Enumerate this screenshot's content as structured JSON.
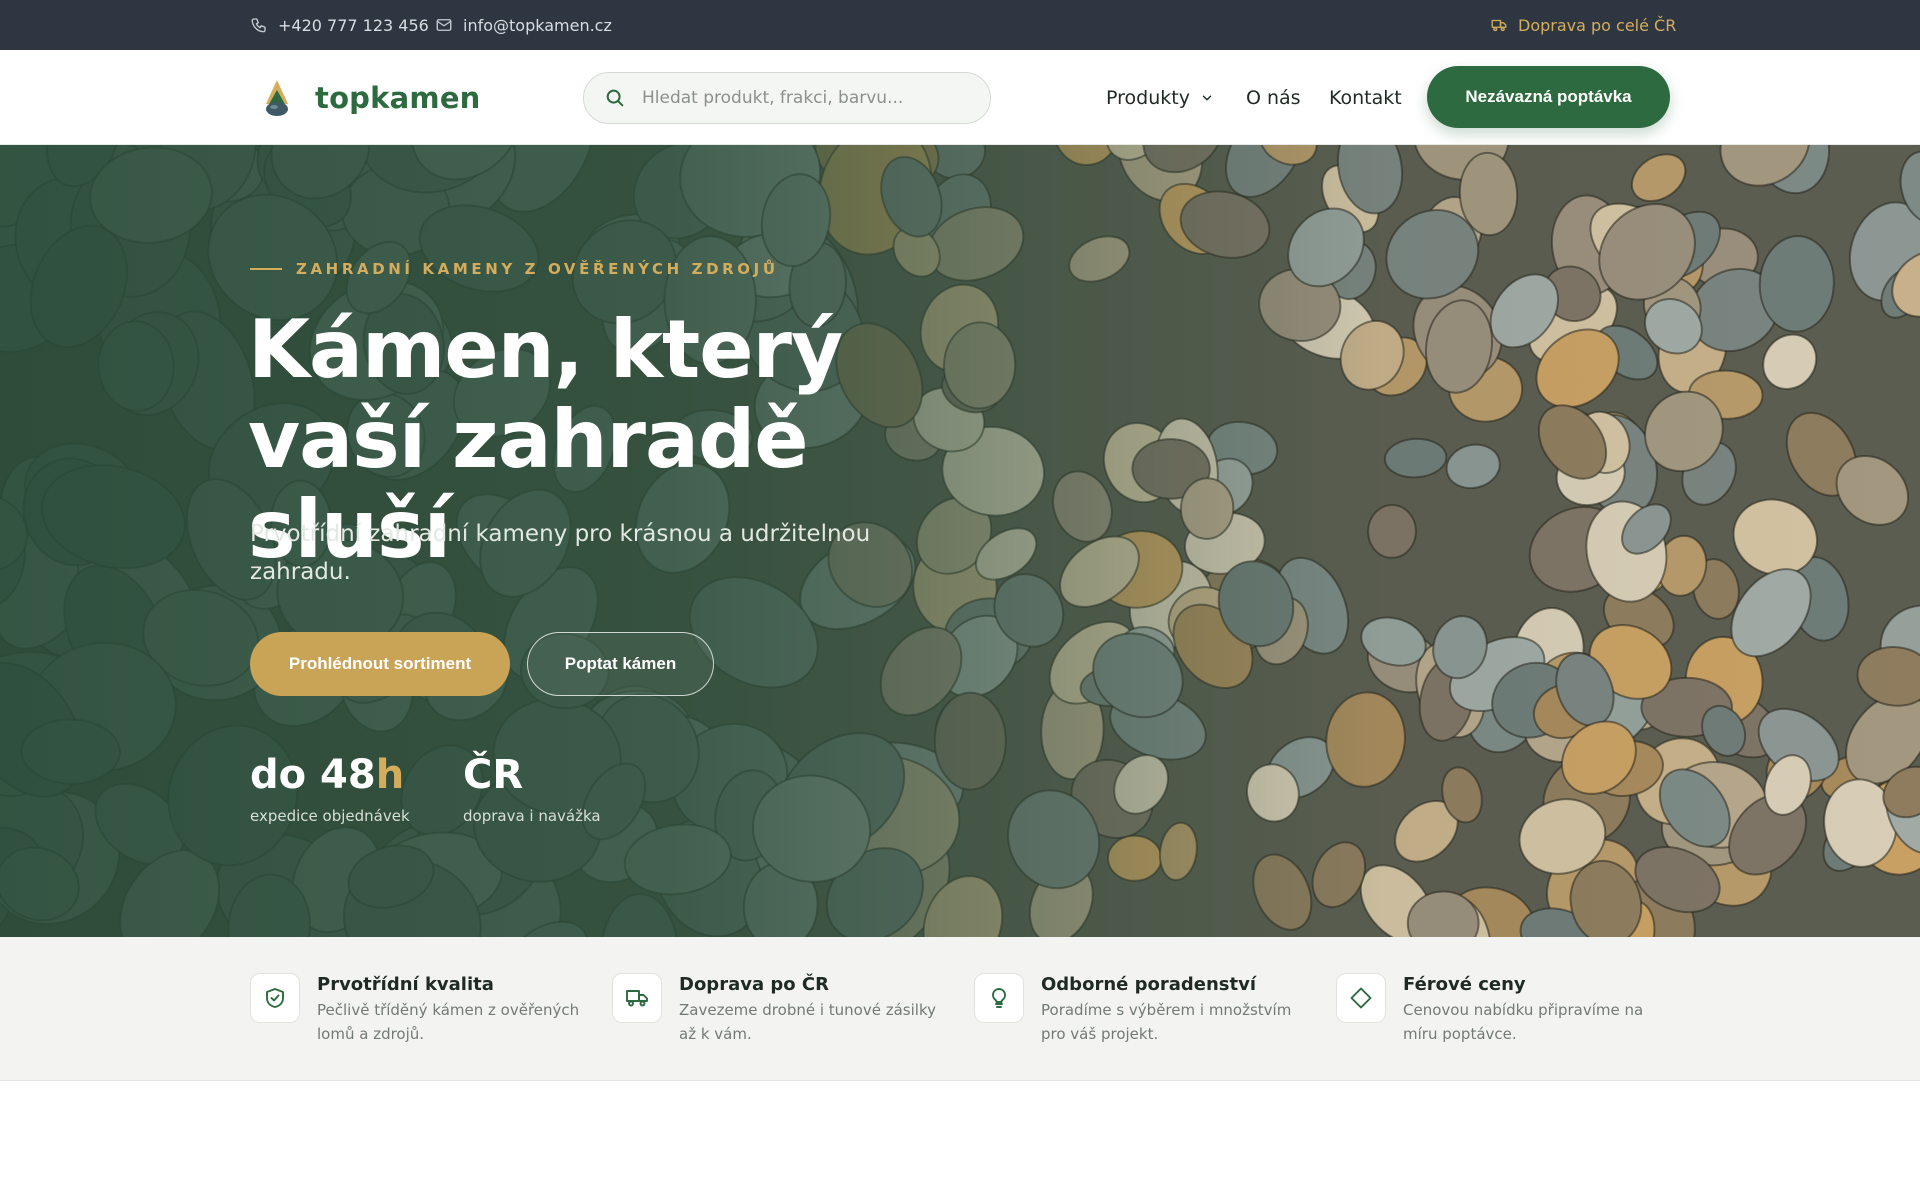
{
  "topbar": {
    "phone": "+420 777 123 456",
    "email": "info@topkamen.cz",
    "delivery": "Doprava po celé ČR"
  },
  "header": {
    "brand": "topkamen",
    "search_placeholder": "Hledat produkt, frakci, barvu...",
    "nav": {
      "products": "Produkty",
      "about": "O nás",
      "contact": "Kontakt"
    },
    "cta": "Nezávazná poptávka"
  },
  "hero": {
    "eyebrow": "ZAHRADNÍ KAMENY Z OVĚŘENÝCH ZDROJŮ",
    "title": "Kámen, který vaší zahradě sluší",
    "lead": "Prvotřídní zahradní kameny pro krásnou a udržitelnou zahradu.",
    "primary_button": "Prohlédnout sortiment",
    "secondary_button": "Poptat kámen",
    "stats": [
      {
        "value": "do 48",
        "value_accent": "h",
        "label": "expedice objednávek"
      },
      {
        "value": "ČR",
        "value_accent": "",
        "label": "doprava i navážka"
      }
    ]
  },
  "features": [
    {
      "icon": "shield-check-icon",
      "title": "Prvotřídní kvalita",
      "desc": "Pečlivě tříděný kámen z ověřených lomů a zdrojů."
    },
    {
      "icon": "truck-icon",
      "title": "Doprava po ČR",
      "desc": "Zavezeme drobné i tunové zásilky až k vám."
    },
    {
      "icon": "lightbulb-icon",
      "title": "Odborné poradenství",
      "desc": "Poradíme s výběrem i množstvím pro váš projekt."
    },
    {
      "icon": "diamond-icon",
      "title": "Férové ceny",
      "desc": "Cenovou nabídku připravíme na míru poptávce."
    }
  ],
  "colors": {
    "brand_green": "#2d6a3f",
    "accent_gold": "#c9a356",
    "topbar_bg": "#2e3641"
  }
}
